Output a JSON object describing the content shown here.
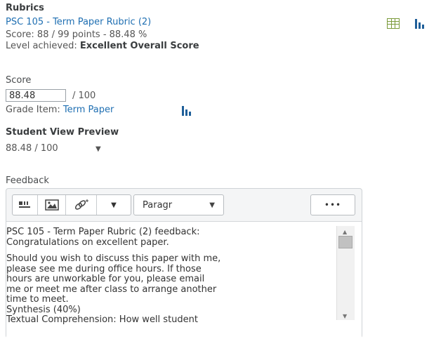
{
  "rubrics": {
    "heading": "Rubrics",
    "rubric_name": "PSC 105 - Term Paper Rubric (2)",
    "score_line": "Score: 88 / 99 points - 88.48 %",
    "level_label": "Level achieved: ",
    "level_value": "Excellent Overall Score",
    "icons": [
      "grid-icon",
      "bar-chart-icon"
    ]
  },
  "score": {
    "heading": "Score",
    "value": "88.48",
    "out_of": "/ 100",
    "grade_item_label": "Grade Item: ",
    "grade_item_link": "Term Paper"
  },
  "student_view": {
    "heading": "Student View Preview",
    "value": "88.48 / 100"
  },
  "feedback": {
    "heading": "Feedback",
    "toolbar": {
      "paragraph_select": "Paragr",
      "more_label": "•••"
    },
    "paragraphs": [
      "PSC 105 - Term Paper Rubric (2) feedback:\nCongratulations on excellent paper.",
      "Should you wish to discuss this paper with me,\nplease see me during office hours. If those\nhours are unworkable for you, please email\nme or meet me after class to arrange another\ntime to meet.\nSynthesis (40%)\nTextual Comprehension: How well student"
    ]
  },
  "colors": {
    "link": "#1f6fb2",
    "text": "#494c4e",
    "grid_icon": "#7a9a3a",
    "chart_icon": "#1f5f99"
  }
}
